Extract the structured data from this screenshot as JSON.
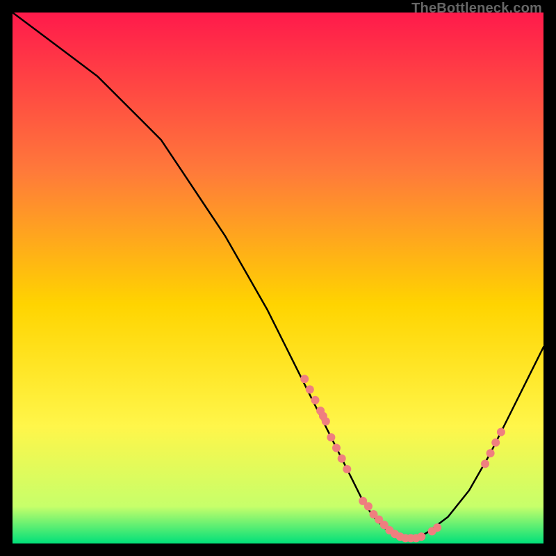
{
  "watermark": "TheBottleneck.com",
  "colors": {
    "gradient_top": "#ff1a4b",
    "gradient_mid1": "#ff7a3a",
    "gradient_mid2": "#ffd400",
    "gradient_mid3": "#fff64a",
    "gradient_bottom1": "#c7ff6a",
    "gradient_bottom2": "#00e07a",
    "curve": "#000000",
    "dots": "#ef7f7f",
    "bg": "#000000"
  },
  "chart_data": {
    "type": "line",
    "title": "",
    "xlabel": "",
    "ylabel": "",
    "xlim": [
      0,
      100
    ],
    "ylim": [
      0,
      100
    ],
    "series": [
      {
        "name": "bottleneck-curve",
        "x": [
          0,
          4,
          8,
          12,
          16,
          20,
          24,
          28,
          32,
          36,
          40,
          44,
          48,
          52,
          56,
          58,
          60,
          62,
          64,
          66,
          68,
          70,
          72,
          74,
          76,
          78,
          82,
          86,
          90,
          94,
          98,
          100
        ],
        "y": [
          100,
          97,
          94,
          91,
          88,
          84,
          80,
          76,
          70,
          64,
          58,
          51,
          44,
          36,
          28,
          24,
          20,
          16,
          12,
          8,
          5,
          3,
          1.5,
          1,
          1,
          2,
          5,
          10,
          17,
          25,
          33,
          37
        ]
      }
    ],
    "scatter": [
      {
        "name": "marker-dots",
        "x": [
          55,
          56,
          57,
          58,
          58.5,
          59,
          60,
          61,
          62,
          63,
          66,
          67,
          68,
          69,
          70,
          71,
          72,
          73,
          74,
          75,
          76,
          77,
          79,
          80,
          89,
          90,
          91,
          92
        ],
        "y": [
          31,
          29,
          27,
          25,
          24,
          23,
          20,
          18,
          16,
          14,
          8,
          7,
          5.5,
          4.5,
          3.5,
          2.5,
          1.8,
          1.3,
          1,
          1,
          1,
          1.3,
          2.3,
          3,
          15,
          17,
          19,
          21
        ]
      }
    ]
  }
}
